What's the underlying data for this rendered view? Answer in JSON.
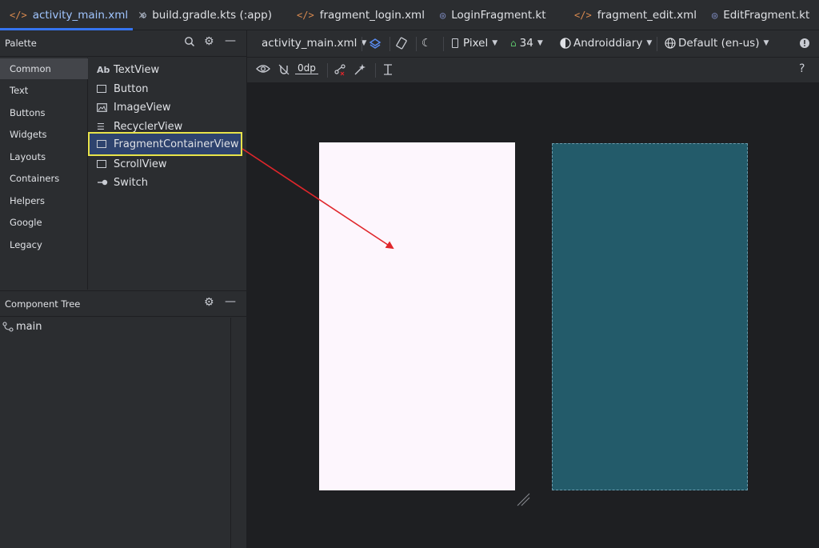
{
  "tabs": [
    {
      "label": "activity_main.xml",
      "icon": "xml-file-icon",
      "active": true,
      "close": "×"
    },
    {
      "label": "build.gradle.kts (:app)",
      "icon": "gradle-file-icon"
    },
    {
      "label": "fragment_login.xml",
      "icon": "xml-file-icon"
    },
    {
      "label": "LoginFragment.kt",
      "icon": "kotlin-file-icon"
    },
    {
      "label": "fragment_edit.xml",
      "icon": "xml-file-icon"
    },
    {
      "label": "EditFragment.kt",
      "icon": "kotlin-file-icon"
    }
  ],
  "palette": {
    "title": "Palette",
    "categories": [
      "Common",
      "Text",
      "Buttons",
      "Widgets",
      "Layouts",
      "Containers",
      "Helpers",
      "Google",
      "Legacy"
    ],
    "selected_category": "Common",
    "widgets": [
      {
        "label": "TextView",
        "icon_text": "Ab"
      },
      {
        "label": "Button"
      },
      {
        "label": "ImageView"
      },
      {
        "label": "RecyclerView"
      },
      {
        "label": "FragmentContainerView",
        "highlighted": true
      },
      {
        "label": "ScrollView"
      },
      {
        "label": "Switch"
      }
    ]
  },
  "component_tree": {
    "title": "Component Tree",
    "items": [
      {
        "label": "main"
      }
    ]
  },
  "design_toolbar": {
    "file": "activity_main.xml",
    "device": "Pixel",
    "api": "34",
    "theme": "Androiddiary",
    "locale": "Default (en-us)"
  },
  "design_toolbar2": {
    "margin": "0dp",
    "help": "?"
  },
  "colors": {
    "accent": "#3574f0",
    "highlight_border": "#e8e34a",
    "arrow": "#e0262b",
    "design_surface": "#fdf6fd",
    "blueprint_surface": "#235b6a"
  }
}
